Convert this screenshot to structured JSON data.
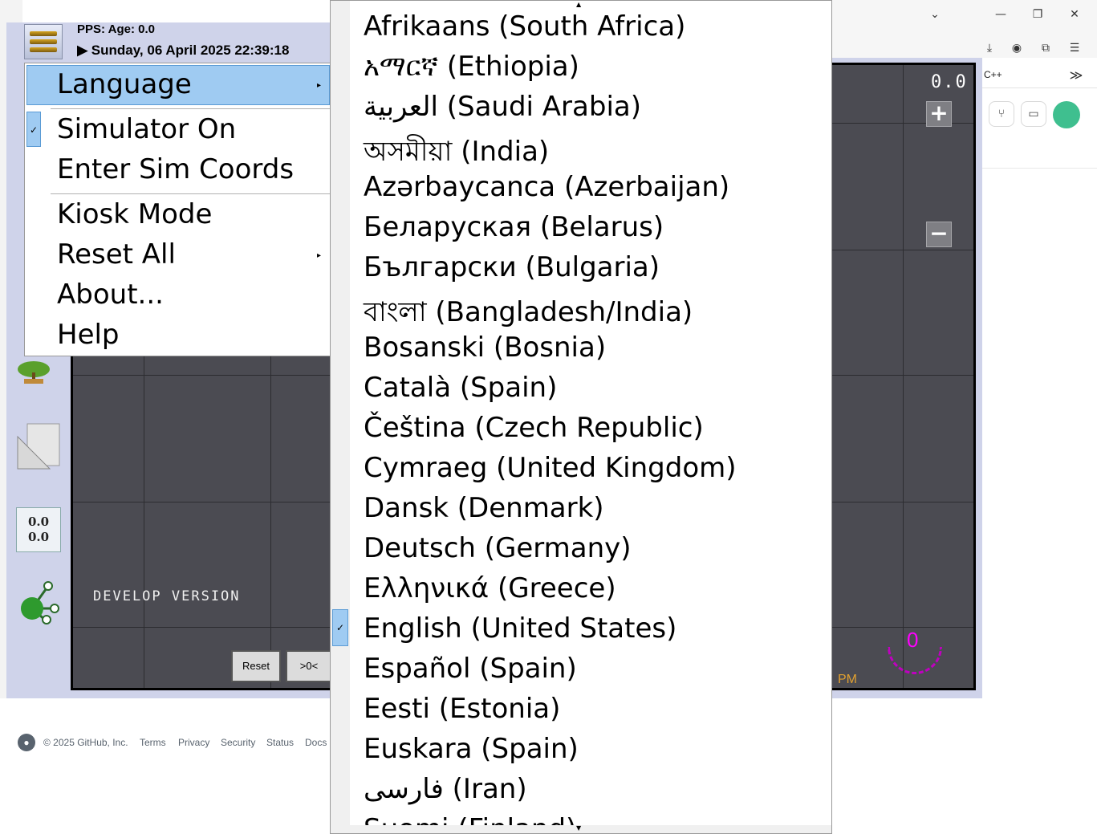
{
  "app": {
    "pps_label": "PPS: Age: 0.0",
    "date": "▶ Sunday, 06 April 2025 22:39:18",
    "develop_version": "DEVELOP VERSION",
    "zoom_readout": "0.0",
    "zoom_in": "+",
    "zoom_out": "−",
    "coords_line1": "0.0",
    "coords_line2": "0.0",
    "compass_value": "0",
    "time_suffix": "PM",
    "reset_button": "Reset",
    "center_button": ">0<",
    "close_button": "✖"
  },
  "context_menu": {
    "items": [
      {
        "label": "Language",
        "submenu": true,
        "selected": true
      },
      {
        "label": "Simulator On",
        "checked": true
      },
      {
        "label": "Enter Sim Coords"
      },
      {
        "label": "Kiosk Mode"
      },
      {
        "label": "Reset All",
        "submenu": true
      },
      {
        "label": "About..."
      },
      {
        "label": "Help"
      }
    ]
  },
  "language_menu": {
    "checked": "English (United States)",
    "items": [
      "Afrikaans (South Africa)",
      "አማርኛ (Ethiopia)",
      "العربية (Saudi Arabia)",
      "অসমীয়া (India)",
      "Azərbaycanca (Azerbaijan)",
      "Беларуская (Belarus)",
      "Български (Bulgaria)",
      "বাংলা (Bangladesh/India)",
      "Bosanski (Bosnia)",
      "Català (Spain)",
      "Čeština (Czech Republic)",
      "Cymraeg (United Kingdom)",
      "Dansk (Denmark)",
      "Deutsch (Germany)",
      "Ελληνικά (Greece)",
      "English (United States)",
      "Español (Spain)",
      "Eesti (Estonia)",
      "Euskara (Spain)",
      "فارسی (Iran)",
      "Suomi (Finland)"
    ]
  },
  "browser": {
    "bookmark_label": "C++",
    "more": "≫"
  },
  "footer": {
    "copyright": "© 2025 GitHub, Inc.",
    "links": [
      "Terms",
      "Privacy",
      "Security",
      "Status",
      "Docs"
    ]
  },
  "colors": {
    "menu_highlight": "#9fcbf2",
    "map_background": "#4b4b52",
    "compass": "#ff00ff",
    "close_red": "#d42a20"
  }
}
